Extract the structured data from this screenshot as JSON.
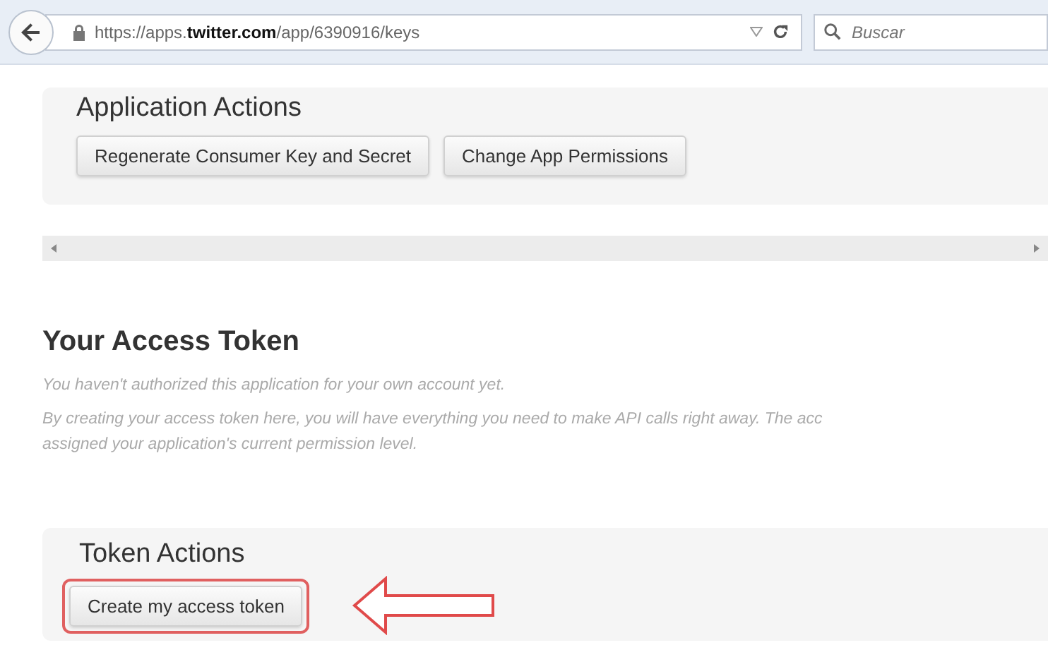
{
  "browser": {
    "url": "https://apps.**twitter.com**/app/6390916/keys",
    "search": {
      "placeholder": "Buscar"
    }
  },
  "application_actions": {
    "title": "Application Actions",
    "buttons": [
      "Regenerate Consumer Key and Secret",
      "Change App Permissions"
    ]
  },
  "access_token": {
    "title": "Your Access Token",
    "notes": [
      "You haven't authorized this application for your own account yet.",
      "By creating your access token here, you will have everything you need to make API calls right away. The acc\nassigned your application's current permission level."
    ]
  },
  "token_actions": {
    "title": "Token Actions",
    "buttons": [
      {
        "label": "Create my access token",
        "highlighted": true
      }
    ]
  }
}
